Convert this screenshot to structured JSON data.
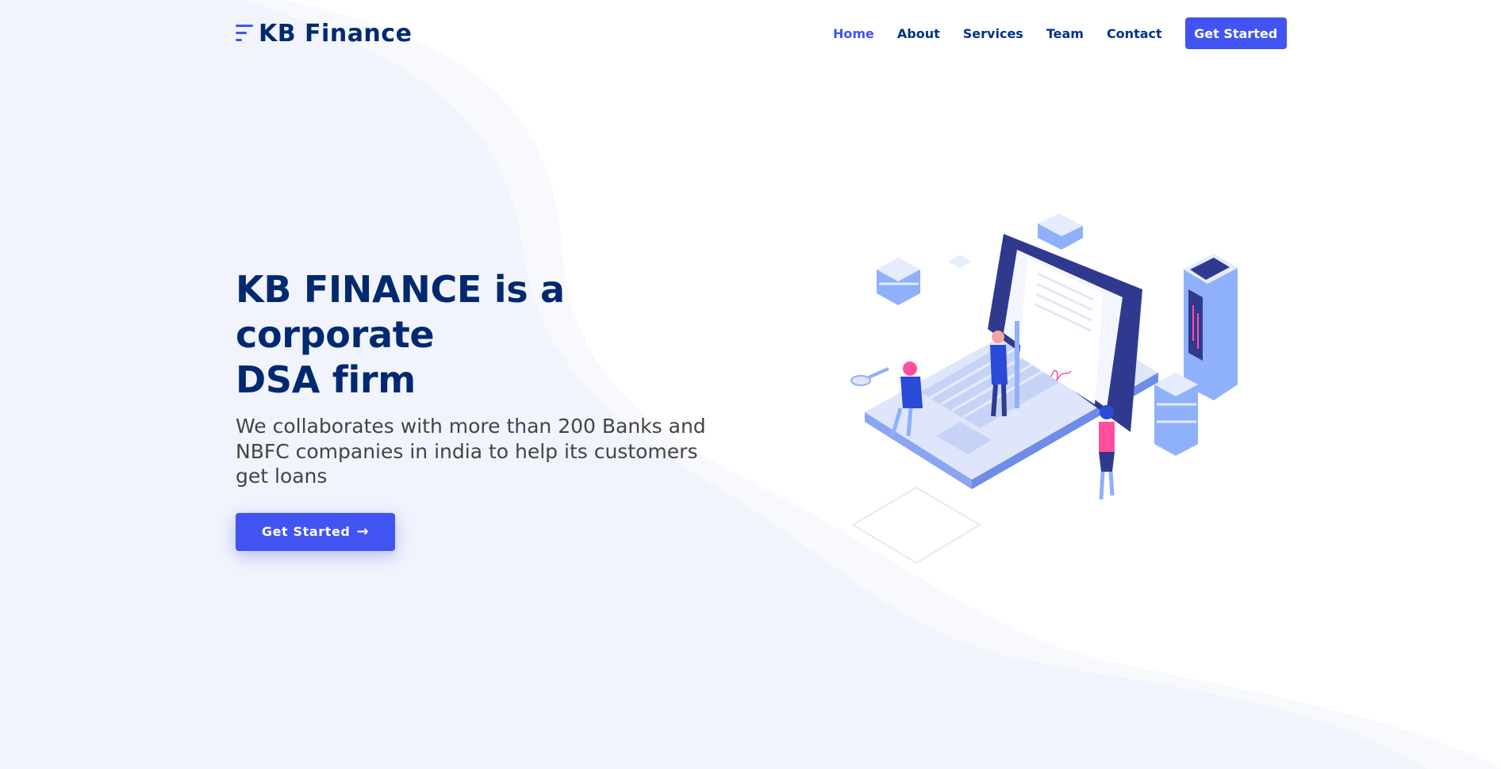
{
  "brand": {
    "name": "KB Finance"
  },
  "nav": {
    "items": [
      {
        "label": "Home",
        "active": true
      },
      {
        "label": "About"
      },
      {
        "label": "Services"
      },
      {
        "label": "Team"
      },
      {
        "label": "Contact"
      }
    ],
    "cta_label": "Get Started"
  },
  "hero": {
    "title_line1": "KB FINANCE is a corporate",
    "title_line2": "DSA firm",
    "subtitle": "We collaborates with more than 200 Banks and NBFC companies in india to help its customers get loans",
    "button_label": "Get Started"
  },
  "colors": {
    "accent": "#4154f1",
    "heading": "#012970",
    "nav_text": "#013289",
    "body_text": "#444444",
    "wave_bg": "#f1f4fc"
  }
}
